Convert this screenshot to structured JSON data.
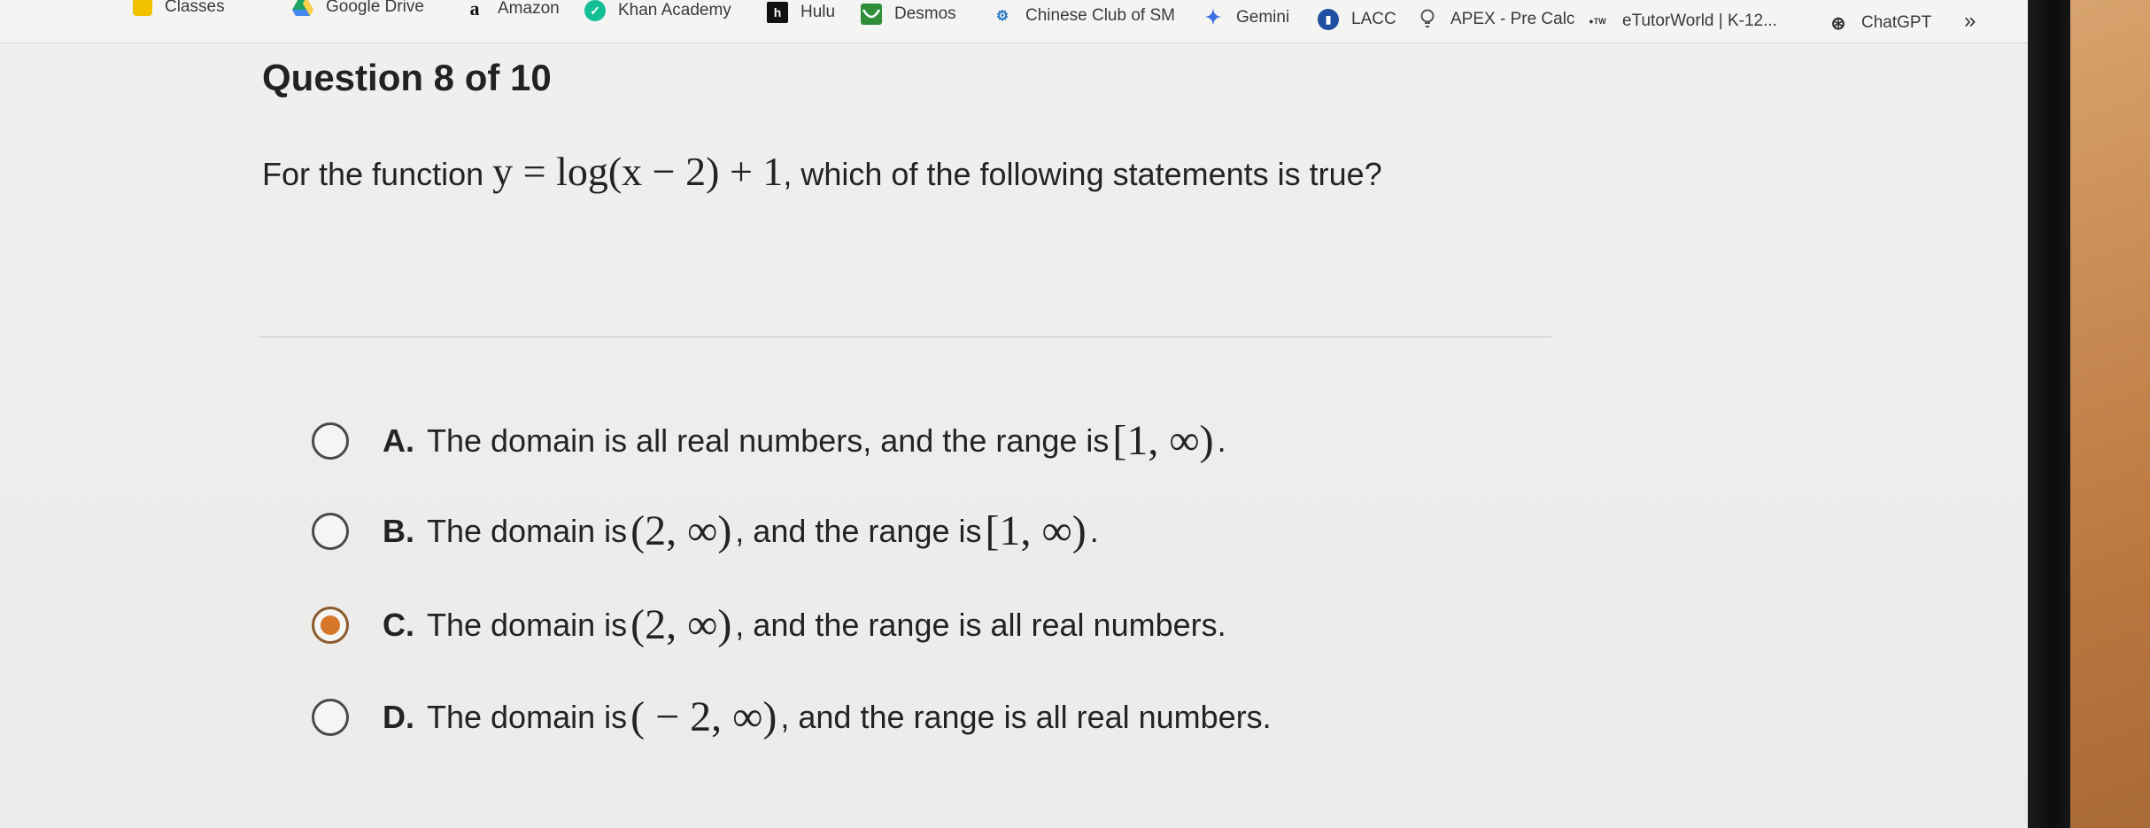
{
  "bookmarks": [
    {
      "label": "Classes",
      "icon": "classes-icon"
    },
    {
      "label": "Google Drive",
      "icon": "google-drive-icon"
    },
    {
      "label": "Amazon",
      "icon": "amazon-icon"
    },
    {
      "label": "Khan Academy",
      "icon": "khan-academy-icon"
    },
    {
      "label": "Hulu",
      "icon": "hulu-icon"
    },
    {
      "label": "Desmos",
      "icon": "desmos-icon"
    },
    {
      "label": "Chinese Club of SM",
      "icon": "chinese-club-icon"
    },
    {
      "label": "Gemini",
      "icon": "gemini-icon"
    },
    {
      "label": "LACC",
      "icon": "lacc-icon"
    },
    {
      "label": "APEX - Pre Calc",
      "icon": "apex-icon"
    },
    {
      "label": "eTutorWorld | K-12...",
      "icon": "etutorworld-icon"
    },
    {
      "label": "ChatGPT",
      "icon": "chatgpt-icon"
    }
  ],
  "overflow_label": "»",
  "question": {
    "title": "Question 8 of 10",
    "prompt_before": "For the function ",
    "function": "y = log(x − 2) + 1",
    "prompt_after": ", which of the following statements is true?"
  },
  "options": [
    {
      "letter": "A.",
      "text_1": "The domain is all real numbers, and the range is ",
      "math_1": "[1, ∞)",
      "text_2": ".",
      "math_2": "",
      "text_3": "",
      "selected": false
    },
    {
      "letter": "B.",
      "text_1": "The domain is ",
      "math_1": "(2, ∞)",
      "text_2": ", and the range is ",
      "math_2": "[1, ∞)",
      "text_3": ".",
      "selected": false
    },
    {
      "letter": "C.",
      "text_1": "The domain is ",
      "math_1": "(2, ∞)",
      "text_2": ", and the range is all real numbers.",
      "math_2": "",
      "text_3": "",
      "selected": true
    },
    {
      "letter": "D.",
      "text_1": "The domain is ",
      "math_1": "( − 2, ∞)",
      "text_2": ", and the range is all real numbers.",
      "math_2": "",
      "text_3": "",
      "selected": false
    }
  ],
  "colors": {
    "selected_radio": "#d6782c",
    "page_background": "#ececea"
  }
}
